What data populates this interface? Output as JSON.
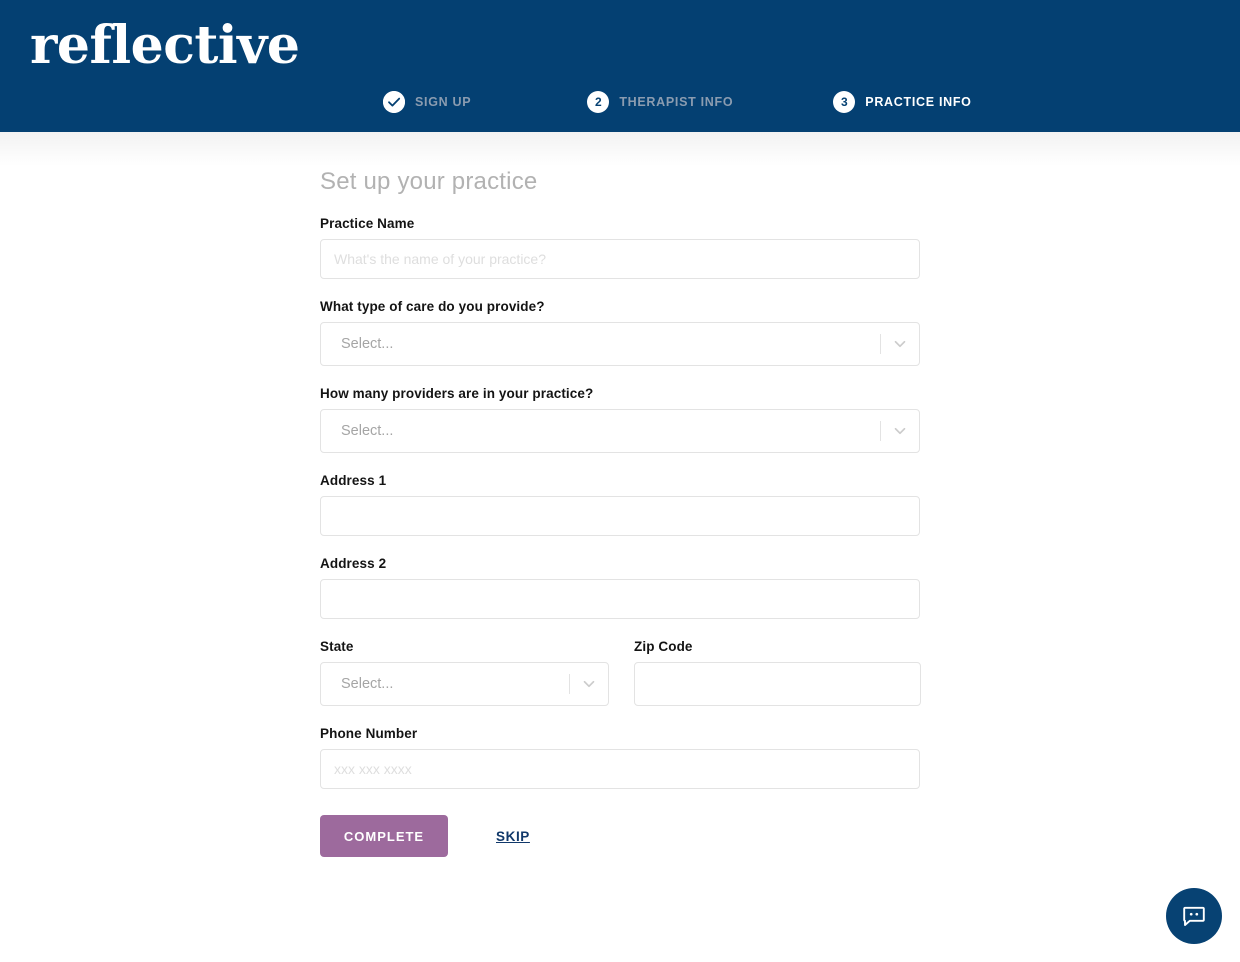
{
  "header": {
    "logo_text": "reflective",
    "brand_navy": "#044072",
    "stepper": [
      {
        "marker": "check",
        "label": "SIGN UP",
        "state": "done"
      },
      {
        "marker": "2",
        "label": "THERAPIST INFO",
        "state": "pending"
      },
      {
        "marker": "3",
        "label": "PRACTICE INFO",
        "state": "active"
      }
    ]
  },
  "main": {
    "page_title": "Set up your practice",
    "fields": {
      "practice_name": {
        "label": "Practice Name",
        "placeholder": "What's the name of your practice?",
        "value": ""
      },
      "care_type": {
        "label": "What type of care do you provide?",
        "placeholder": "Select...",
        "value": ""
      },
      "provider_count": {
        "label": "How many providers are in your practice?",
        "placeholder": "Select...",
        "value": ""
      },
      "address_1": {
        "label": "Address 1",
        "placeholder": "",
        "value": ""
      },
      "address_2": {
        "label": "Address 2",
        "placeholder": "",
        "value": ""
      },
      "state": {
        "label": "State",
        "placeholder": "Select...",
        "value": ""
      },
      "zip_code": {
        "label": "Zip Code",
        "placeholder": "",
        "value": ""
      },
      "phone_number": {
        "label": "Phone Number",
        "placeholder": "xxx xxx xxxx",
        "value": ""
      }
    },
    "actions": {
      "complete_label": "COMPLETE",
      "complete_color": "#9d6a9d",
      "skip_label": "SKIP",
      "skip_color": "#10386a"
    }
  },
  "chat_widget": {
    "icon": "chat-bubble-icon",
    "color": "#074273"
  }
}
